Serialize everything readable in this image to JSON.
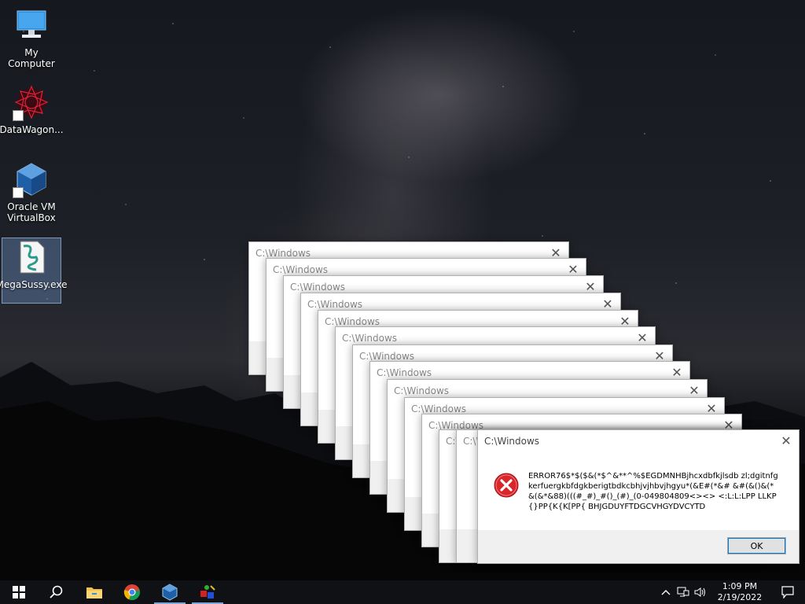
{
  "desktop": {
    "icons": [
      {
        "label": "My Computer",
        "icon": "monitor-icon"
      },
      {
        "label": "DataWagon...",
        "icon": "datawagon-icon"
      },
      {
        "label": "Oracle VM VirtualBox",
        "icon": "virtualbox-icon"
      },
      {
        "label": "MegaSussy.exe",
        "icon": "script-file-icon"
      }
    ]
  },
  "dialogs": {
    "stack_title": "C:\\Windows",
    "main": {
      "title": "C:\\Windows",
      "message": "ERROR76$*$($&(*$^&**^%$EGDMNHBjhcxdbfkjlsdb zl;dgitnfgkerfuergkbfdgkberigtbdkcbhjvjhbvjhgyu*(&E#(*&# &#(&()&(*&(&*&88)(((#_#)_#()_(#)_(0-049804809<><> <:L:L:LPP LLKP{}PP{K{K[PP{ BHJGDUYFTDGCVHGYDVCYTD",
      "ok_label": "OK"
    }
  },
  "taskbar": {
    "items": [
      "start-icon",
      "search-icon",
      "file-explorer-icon",
      "chrome-icon",
      "virtualbox-icon",
      "paint-icon"
    ],
    "clock_time": "1:09 PM",
    "clock_date": "2/19/2022"
  },
  "colors": {
    "taskbar_bg": "#101114",
    "error_red": "#d9262a",
    "button_focus": "#0078d7"
  }
}
